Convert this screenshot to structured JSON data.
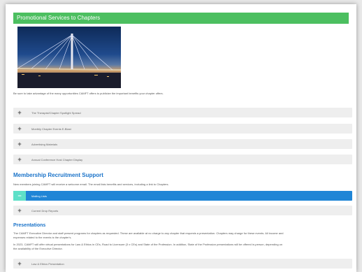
{
  "banner": {
    "title": "Promotional Services to Chapters"
  },
  "intro": "Be sure to take advantage of the many opportunities CAMFT offers to publicize the important benefits your chapter offers.",
  "promo_items": [
    {
      "label": "The Therapist/Chapter Spotlight Spread"
    },
    {
      "label": "Monthly Chapter Events E-Blast"
    },
    {
      "label": "Advertising Materials"
    },
    {
      "label": "Annual Conference Host Chapter Display"
    }
  ],
  "membership": {
    "heading": "Membership Recruitment Support",
    "text": "New members joining CAMFT will receive a welcome email.  The email lists benefits and services, including a link to Chapters.",
    "items": [
      {
        "label": "Mailing Lists",
        "toggle": "−"
      },
      {
        "label": "Current Drop Reports",
        "toggle": "+"
      }
    ]
  },
  "presentations": {
    "heading": "Presentations",
    "para1a": "The CAMFT Executive Director and staff present programs for chapters as requested. These are available at no charge to any chapter that requests a presentation. Chapters may charge for these events. All income and",
    "para1b": "expenses related to the events is the chapter's.",
    "para2a": "In 2023, CAMFT will offer virtual presentations for Law & Ethics in CEs, Road to Licensure (3 x CEs) and State of the Profession. In addition, State of the Profession presentations will be offered in-person, depending on",
    "para2b": "the availability of the Executive Director.",
    "items": [
      {
        "label": "Law & Ethics Presentation"
      }
    ]
  },
  "toggle_plus": "+",
  "colors": {
    "banner": "#4cbf60",
    "accent": "#1a73c9",
    "active_row": "#1f85d6",
    "active_toggle": "#5ee0c8"
  }
}
